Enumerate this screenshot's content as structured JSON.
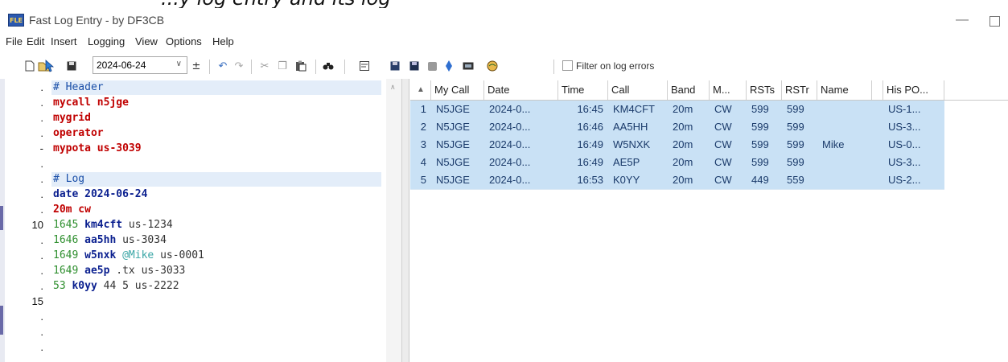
{
  "window": {
    "title": "Fast Log Entry - by DF3CB",
    "icon_label": "FLE",
    "top_strip_text": "...y log entry and its log"
  },
  "menu": [
    "File",
    "Edit",
    "Insert",
    "Logging",
    "View",
    "Options",
    "Help"
  ],
  "toolbar": {
    "date_value": "2024-06-24",
    "filter_label": "Filter on log errors",
    "icons": [
      "new-icon",
      "open-icon",
      "save-icon",
      "date-dropdown-icon",
      "date-step-icon",
      "undo-icon",
      "redo-icon",
      "cut-icon",
      "copy-icon",
      "paste-icon",
      "find-icon",
      "edit-icon",
      "save-adi-icon",
      "save-cabrillo-icon",
      "stop-icon",
      "diamond-icon",
      "qsl-icon",
      "map-icon"
    ]
  },
  "editor": {
    "lines": [
      {
        "ln": ".",
        "parts": [
          [
            "hdr",
            "# Header"
          ]
        ],
        "hl": true
      },
      {
        "ln": ".",
        "parts": [
          [
            "cmd",
            "mycall n5jge"
          ]
        ]
      },
      {
        "ln": ".",
        "parts": [
          [
            "cmd",
            "mygrid"
          ]
        ]
      },
      {
        "ln": ".",
        "parts": [
          [
            "cmd",
            "operator"
          ]
        ]
      },
      {
        "ln": "-",
        "parts": [
          [
            "cmd",
            "mypota us-3039"
          ]
        ]
      },
      {
        "ln": ".",
        "parts": []
      },
      {
        "ln": ".",
        "parts": [
          [
            "hdr",
            "# Log"
          ]
        ],
        "hl": true
      },
      {
        "ln": ".",
        "parts": [
          [
            "dt",
            "date 2024-06-24"
          ]
        ]
      },
      {
        "ln": ".",
        "parts": [
          [
            "cmd",
            "20m cw"
          ]
        ]
      },
      {
        "ln": "10",
        "parts": [
          [
            "tm",
            "1645 "
          ],
          [
            "cs",
            "km4cft"
          ],
          [
            "rest",
            " us-1234"
          ]
        ]
      },
      {
        "ln": ".",
        "parts": [
          [
            "tm",
            "1646 "
          ],
          [
            "cs",
            "aa5hh"
          ],
          [
            "rest",
            " us-3034"
          ]
        ]
      },
      {
        "ln": ".",
        "parts": [
          [
            "tm",
            "1649 "
          ],
          [
            "cs",
            "w5nxk"
          ],
          [
            "nm",
            " @Mike"
          ],
          [
            "rest",
            " us-0001"
          ]
        ]
      },
      {
        "ln": ".",
        "parts": [
          [
            "tm",
            "1649 "
          ],
          [
            "cs",
            "ae5p"
          ],
          [
            "rest",
            " .tx us-3033"
          ]
        ]
      },
      {
        "ln": ".",
        "parts": [
          [
            "tm",
            "53 "
          ],
          [
            "cs",
            "k0yy"
          ],
          [
            "rest",
            " 44 5 us-2222"
          ]
        ]
      },
      {
        "ln": "15",
        "parts": []
      },
      {
        "ln": ".",
        "parts": []
      },
      {
        "ln": ".",
        "parts": []
      },
      {
        "ln": ".",
        "parts": []
      }
    ]
  },
  "grid": {
    "sort_indicator": "▲",
    "columns": [
      "My Call",
      "Date",
      "Time",
      "Call",
      "Band",
      "M...",
      "RSTs",
      "RSTr",
      "Name",
      "",
      "His PO..."
    ],
    "rows": [
      [
        "1",
        "N5JGE",
        "2024-0...",
        "16:45",
        "KM4CFT",
        "20m",
        "CW",
        "599",
        "599",
        "",
        "",
        "US-1..."
      ],
      [
        "2",
        "N5JGE",
        "2024-0...",
        "16:46",
        "AA5HH",
        "20m",
        "CW",
        "599",
        "599",
        "",
        "",
        "US-3..."
      ],
      [
        "3",
        "N5JGE",
        "2024-0...",
        "16:49",
        "W5NXK",
        "20m",
        "CW",
        "599",
        "599",
        "Mike",
        "",
        "US-0..."
      ],
      [
        "4",
        "N5JGE",
        "2024-0...",
        "16:49",
        "AE5P",
        "20m",
        "CW",
        "599",
        "599",
        "",
        "",
        "US-3..."
      ],
      [
        "5",
        "N5JGE",
        "2024-0...",
        "16:53",
        "K0YY",
        "20m",
        "CW",
        "449",
        "559",
        "",
        "",
        "US-2..."
      ]
    ]
  },
  "colors": {
    "row_bg": "#c9e1f5",
    "highlight": "#e3edf9",
    "command": "#c00000",
    "callsign": "#0a1f8f",
    "time": "#2f8f2f"
  }
}
